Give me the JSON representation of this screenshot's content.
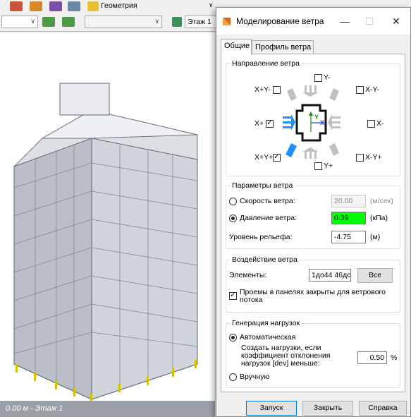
{
  "app": {
    "toolbar_label": "Геометрия",
    "floor_combo": "Этаж 1",
    "status": "0.00 м - Этаж 1"
  },
  "dialog": {
    "title": "Моделирование ветра",
    "tabs": [
      "Общие",
      "Профиль ветра"
    ],
    "direction": {
      "legend": "Направление ветра",
      "y_minus": "Y-",
      "xp_ym": "X+Y-",
      "xm_ym": "X-Y-",
      "x_plus": "X+",
      "x_minus": "X-",
      "xp_yp": "X+Y+",
      "xm_yp": "X-Y+",
      "y_plus": "Y+",
      "axis_y": "Y",
      "axis_x": "X"
    },
    "params": {
      "legend": "Параметры ветра",
      "speed_label": "Скорость ветра:",
      "speed_value": "20.00",
      "speed_unit": "(м/сек)",
      "pressure_label": "Давление ветра:",
      "pressure_value": "0.39",
      "pressure_unit": "(кПа)",
      "relief_label": "Уровень рельефа:",
      "relief_value": "-4.75",
      "relief_unit": "(м)"
    },
    "impact": {
      "legend": "Воздействие ветра",
      "elements_label": "Элементы:",
      "elements_value": "1до44 46дс",
      "all_button": "Все",
      "openings_label": "Проемы в панелях закрыты для ветрового потока"
    },
    "generation": {
      "legend": "Генерация нагрузок",
      "auto_label": "Автоматическая",
      "create_label": "Создать нагрузки, если коэффициент отклонения нагрузок [dev] меньше:",
      "coef_value": "0.50",
      "coef_unit": "%",
      "manual_label": "Вручную"
    },
    "buttons": {
      "run": "Запуск",
      "close": "Закрыть",
      "help": "Справка"
    }
  },
  "colors": {
    "highlight": "#00ff00",
    "arrow_active": "#1e90ff",
    "arrow_inactive": "#c0c0c0",
    "logo": "#e06a1c"
  }
}
